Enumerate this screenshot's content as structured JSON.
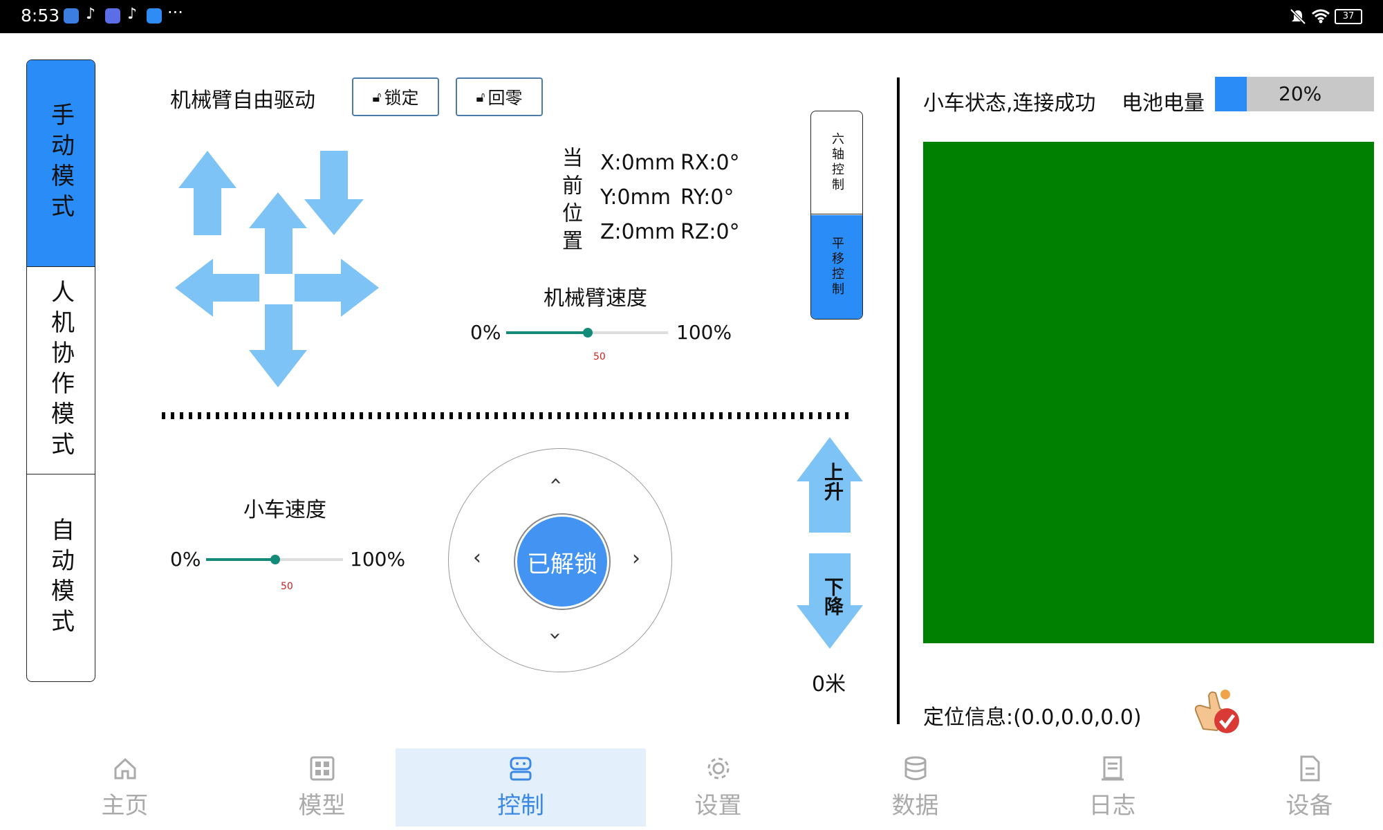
{
  "status_bar": {
    "time": "8:53",
    "more": "···",
    "battery": "37",
    "colors": {
      "background": "#000000"
    }
  },
  "modes": [
    {
      "label": "手动模式",
      "active": true
    },
    {
      "label": "人机协作模式",
      "active": false
    },
    {
      "label": "自动模式",
      "active": false
    }
  ],
  "arm": {
    "title": "机械臂自由驱动",
    "lock_label": "锁定",
    "zero_label": "回零",
    "position_label": "当前位置",
    "x": "X:0mm",
    "rx": "RX:0°",
    "y": "Y:0mm",
    "ry": "RY:0°",
    "z": "Z:0mm",
    "rz": "RZ:0°",
    "speed_title": "机械臂速度",
    "speed_min": "0%",
    "speed_max": "100%",
    "speed_value": "50"
  },
  "axis_toggle": {
    "six_axis": "六轴控制",
    "translate": "平移控制",
    "active": "translate"
  },
  "car": {
    "speed_title": "小车速度",
    "speed_min": "0%",
    "speed_max": "100%",
    "speed_value": "50",
    "unlock_label": "已解锁",
    "up_label": "上升",
    "down_label": "下降",
    "height": "0米"
  },
  "right": {
    "status": "小车状态,连接成功",
    "battery_label": "电池电量",
    "battery_pct": "20%",
    "battery_fraction": 0.2,
    "location": "定位信息:(0.0,0.0,0.0)",
    "colors": {
      "canvas": "#008000",
      "accent": "#2a8cf7"
    }
  },
  "nav": [
    {
      "label": "主页",
      "icon": "home-icon"
    },
    {
      "label": "模型",
      "icon": "grid-icon"
    },
    {
      "label": "控制",
      "icon": "robot-icon",
      "active": true
    },
    {
      "label": "设置",
      "icon": "gear-icon"
    },
    {
      "label": "数据",
      "icon": "database-icon"
    },
    {
      "label": "日志",
      "icon": "log-icon"
    },
    {
      "label": "设备",
      "icon": "document-icon"
    }
  ]
}
